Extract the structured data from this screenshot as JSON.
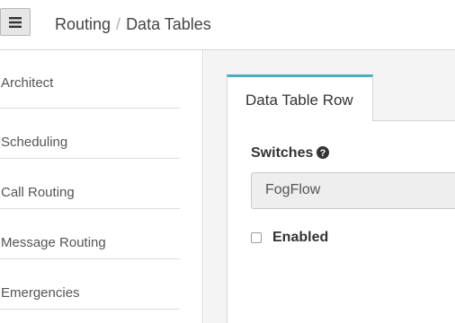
{
  "header": {
    "menu_icon": "hamburger-icon",
    "breadcrumb": [
      "Routing",
      "Data Tables"
    ],
    "separator": "/"
  },
  "sidebar": {
    "items": [
      {
        "label": "Architect"
      },
      {
        "label": "Scheduling"
      },
      {
        "label": "Call Routing"
      },
      {
        "label": "Message Routing"
      },
      {
        "label": "Emergencies"
      }
    ]
  },
  "main": {
    "tab_label": "Data Table Row",
    "field": {
      "label": "Switches",
      "help_icon": "question-circle-icon",
      "value": "FogFlow"
    },
    "checkbox": {
      "label": "Enabled",
      "checked": false
    }
  },
  "colors": {
    "accent": "#4aaebd",
    "content_bg": "#f4f4f4",
    "border": "#d5d5d5"
  }
}
